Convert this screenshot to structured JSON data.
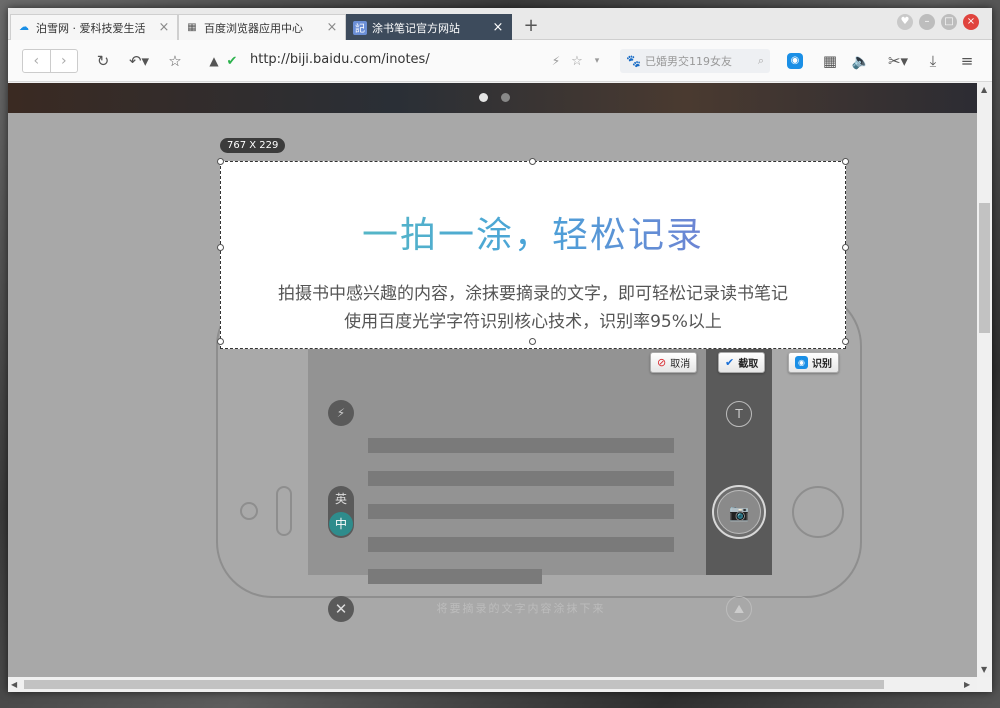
{
  "tabs": [
    {
      "label": "泊雪网 · 爱科技爱生活",
      "icon": "cloud-icon"
    },
    {
      "label": "百度浏览器应用中心",
      "icon": "grid-icon"
    },
    {
      "label": "涂书笔记官方网站",
      "icon": "notes-icon"
    }
  ],
  "toolbar": {
    "url": "http://biji.baidu.com/inotes/",
    "search_placeholder": "已婚男交119女友"
  },
  "capture": {
    "size_label": "767 X 229",
    "headline": "一拍一涂，轻松记录",
    "desc_line1": "拍摄书中感兴趣的内容，涂抹要摘录的文字，即可轻松记录读书笔记",
    "desc_line2": "使用百度光学字符识别核心技术，识别率95%以上",
    "cancel_label": "取消",
    "capture_label": "截取",
    "recognize_label": "识别"
  },
  "phone": {
    "lang_en": "英",
    "lang_zh": "中",
    "hint": "将要摘录的文字内容涂抹下来"
  },
  "colors": {
    "active_tab": "#3d4b5c",
    "accent_blue": "#1a8fe6",
    "cancel_red": "#d8262c"
  }
}
